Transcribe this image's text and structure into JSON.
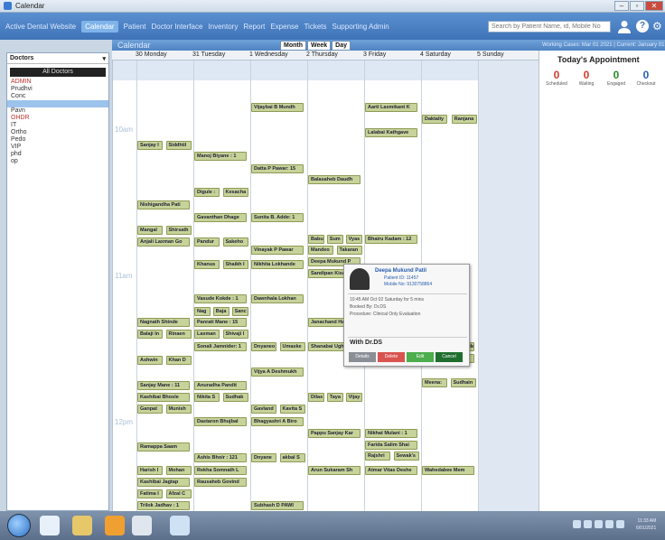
{
  "window": {
    "title": "Calendar",
    "buttons": [
      "–",
      "▫",
      "✕"
    ]
  },
  "menu": {
    "items": [
      "Active Dental Website",
      "Calendar",
      "Patient",
      "Doctor Interface",
      "Inventory",
      "Report",
      "Expense",
      "Tickets",
      "Supporting Admin"
    ],
    "active_index": 1,
    "search_placeholder": "Search by Patient Name, id, Mobile No"
  },
  "calendar": {
    "title": "Calendar",
    "views": [
      "Month",
      "Week",
      "Day"
    ],
    "days": [
      "30 Monday",
      "31 Tuesday",
      "1 Wednesday",
      "2 Thursday",
      "3 Friday",
      "4 Saturday",
      "5 Sunday"
    ],
    "time_labels": [
      "10am",
      "11am",
      "12pm"
    ]
  },
  "doctors": {
    "header": "Doctors",
    "all_label": "All Doctors",
    "list": [
      "ADMIN",
      "Prudhvi",
      "Conc",
      "",
      "Pavn",
      "OHDR",
      "IT",
      "Ortho",
      "Pedo",
      "VIP",
      "phd",
      "op"
    ]
  },
  "events": [
    {
      "d": 2,
      "t": 114,
      "label": "Vijaybai B Mundh"
    },
    {
      "d": 4,
      "t": 114,
      "label": "Aarti Laxmikant K"
    },
    {
      "d": 5,
      "t": 127,
      "label": "Daktaliy"
    },
    {
      "d": 5.52,
      "t": 127,
      "label": "Ranjana"
    },
    {
      "d": 4,
      "t": 142,
      "label": "Lalabai Kathgave"
    },
    {
      "d": 0,
      "t": 156,
      "label": "Sanjay I"
    },
    {
      "d": 0.5,
      "t": 156,
      "label": "Siddhiil"
    },
    {
      "d": 1,
      "t": 168,
      "label": "Manoj Biyane : 1"
    },
    {
      "d": 2,
      "t": 182,
      "label": "Datta P Pawar: 15"
    },
    {
      "d": 3,
      "t": 194,
      "label": "Balasaheb Daudh"
    },
    {
      "d": 1,
      "t": 208,
      "label": "Digule :"
    },
    {
      "d": 1.5,
      "t": 208,
      "label": "Kesacha"
    },
    {
      "d": 0,
      "t": 222,
      "label": "Nishigandha Pati"
    },
    {
      "d": 1,
      "t": 236,
      "label": "Gavanthan Dhage"
    },
    {
      "d": 2,
      "t": 236,
      "label": "Sunita B. Adde: 1"
    },
    {
      "d": 0,
      "t": 250,
      "label": "Mangal"
    },
    {
      "d": 0.5,
      "t": 250,
      "label": "Shirsath"
    },
    {
      "d": 3,
      "t": 260,
      "label": "Babu"
    },
    {
      "d": 3.33,
      "t": 260,
      "label": "Sum"
    },
    {
      "d": 3.66,
      "t": 260,
      "label": "Vyas"
    },
    {
      "d": 4,
      "t": 260,
      "label": "Bhairu Kadam : 12"
    },
    {
      "d": 0,
      "t": 263,
      "label": "Anjali Laxman Go"
    },
    {
      "d": 1,
      "t": 263,
      "label": "Pandur"
    },
    {
      "d": 1.5,
      "t": 263,
      "label": "Sakeho"
    },
    {
      "d": 2,
      "t": 272,
      "label": "Vinayak P Pawar"
    },
    {
      "d": 3,
      "t": 272,
      "label": "Mandeo"
    },
    {
      "d": 3.5,
      "t": 272,
      "label": "Takaran"
    },
    {
      "d": 3,
      "t": 285,
      "label": "Deepa Mukund P"
    },
    {
      "d": 1,
      "t": 288,
      "label": "Khanus"
    },
    {
      "d": 1.5,
      "t": 288,
      "label": "Shaikh I"
    },
    {
      "d": 2,
      "t": 288,
      "label": "Nikhita Lokhande"
    },
    {
      "d": 3,
      "t": 298,
      "label": "Sandipan Kisa"
    },
    {
      "d": 1,
      "t": 326,
      "label": "Vasude Kokde : 1"
    },
    {
      "d": 2,
      "t": 326,
      "label": "Dawnhala Lokhan"
    },
    {
      "d": 1,
      "t": 340,
      "label": "Nag"
    },
    {
      "d": 1.33,
      "t": 340,
      "label": "Baja"
    },
    {
      "d": 1.66,
      "t": 340,
      "label": "Sanc"
    },
    {
      "d": 0,
      "t": 352,
      "label": "Nagnath Shinde"
    },
    {
      "d": 1,
      "t": 352,
      "label": "Panrati Mane : 15"
    },
    {
      "d": 3,
      "t": 352,
      "label": "Janachand Hak"
    },
    {
      "d": 0,
      "t": 365,
      "label": "Balaji In"
    },
    {
      "d": 0.5,
      "t": 365,
      "label": "Rinaen"
    },
    {
      "d": 1,
      "t": 365,
      "label": "Laxman"
    },
    {
      "d": 1.5,
      "t": 365,
      "label": "Shivaji I"
    },
    {
      "d": 1,
      "t": 379,
      "label": "Sonali Jamnider: 1"
    },
    {
      "d": 2,
      "t": 379,
      "label": "Dnyaneo"
    },
    {
      "d": 2.5,
      "t": 379,
      "label": "Umaske"
    },
    {
      "d": 3,
      "t": 379,
      "label": "Shanabai Ugh"
    },
    {
      "d": 5,
      "t": 379,
      "label": "Shalan Abaso Gonde"
    },
    {
      "d": 0,
      "t": 394,
      "label": "Ashwin"
    },
    {
      "d": 0.5,
      "t": 394,
      "label": "Khan D"
    },
    {
      "d": 5,
      "t": 392,
      "label": "Shrishkala Prakas"
    },
    {
      "d": 2,
      "t": 407,
      "label": "Vijya A Deshmukh"
    },
    {
      "d": 5,
      "t": 419,
      "label": "Meena:"
    },
    {
      "d": 5.5,
      "t": 419,
      "label": "Sudhain"
    },
    {
      "d": 0,
      "t": 422,
      "label": "Sanjay Mane : 11"
    },
    {
      "d": 1,
      "t": 422,
      "label": "Anuradha Pandit"
    },
    {
      "d": 0,
      "t": 435,
      "label": "Kashibai Bhosle"
    },
    {
      "d": 1,
      "t": 435,
      "label": "Nikita S"
    },
    {
      "d": 1.5,
      "t": 435,
      "label": "Sudhak"
    },
    {
      "d": 3,
      "t": 435,
      "label": "Dilas"
    },
    {
      "d": 3.33,
      "t": 435,
      "label": "Taya"
    },
    {
      "d": 3.66,
      "t": 435,
      "label": "Vijay"
    },
    {
      "d": 0,
      "t": 448,
      "label": "Ganpat"
    },
    {
      "d": 0.5,
      "t": 448,
      "label": "Munish"
    },
    {
      "d": 2,
      "t": 448,
      "label": "Gavland"
    },
    {
      "d": 2.5,
      "t": 448,
      "label": "Kavita S"
    },
    {
      "d": 1,
      "t": 462,
      "label": "Dastaron Bhujbal"
    },
    {
      "d": 2,
      "t": 462,
      "label": "Bhagyashri A Biro"
    },
    {
      "d": 3,
      "t": 475,
      "label": "Pappu Sanjay Kar"
    },
    {
      "d": 4,
      "t": 475,
      "label": "Nikhat Mulani : 1"
    },
    {
      "d": 4,
      "t": 488,
      "label": "Farida Salim Shai"
    },
    {
      "d": 0,
      "t": 490,
      "label": "Ramappa Saam"
    },
    {
      "d": 4,
      "t": 500,
      "label": "Rajshri"
    },
    {
      "d": 4.5,
      "t": 500,
      "label": "Sewak's"
    },
    {
      "d": 1,
      "t": 502,
      "label": "Ashis Bhoir : 121"
    },
    {
      "d": 2,
      "t": 502,
      "label": "Dnyane"
    },
    {
      "d": 2.5,
      "t": 502,
      "label": "akbal S"
    },
    {
      "d": 0,
      "t": 516,
      "label": "Harish I"
    },
    {
      "d": 0.5,
      "t": 516,
      "label": "Mohan"
    },
    {
      "d": 1,
      "t": 516,
      "label": "Rekha Somnath L"
    },
    {
      "d": 3,
      "t": 516,
      "label": "Arun Sukaram Sh"
    },
    {
      "d": 4,
      "t": 516,
      "label": "Atmar Vitas Deshe"
    },
    {
      "d": 5,
      "t": 516,
      "label": "Wahedabee Mem"
    },
    {
      "d": 0,
      "t": 529,
      "label": "Kashibai Jagtap"
    },
    {
      "d": 1,
      "t": 529,
      "label": "Rausaheb Govind"
    },
    {
      "d": 0,
      "t": 542,
      "label": "Fatima I"
    },
    {
      "d": 0.5,
      "t": 542,
      "label": "Afzal C"
    },
    {
      "d": 0,
      "t": 555,
      "label": "Trilok Jadhav : 1"
    },
    {
      "d": 2,
      "t": 555,
      "label": "Subhash D PAWI"
    }
  ],
  "popup": {
    "name": "Deepa Mukund Patil",
    "patient_id": "Patient ID: 11457",
    "mobile": "Mobile No: 9130758864",
    "time": "10:45 AM Oct 02 Saturday for 5 mins",
    "booked": "Booked By: Dr.DS",
    "procedure": "Procedure: Clinical Only Evaluation",
    "with": "With Dr.DS",
    "buttons": [
      "Details",
      "Delete",
      "Edit",
      "Cancel"
    ],
    "button_colors": [
      "#8a8f96",
      "#d9534f",
      "#4cae4c",
      "#1f6e2f"
    ]
  },
  "right_panel": {
    "header": "Working Cases: Mar 01 2021 | Current: January 01 2021",
    "title": "Today's Appointment",
    "stats": [
      {
        "num": "0",
        "label": "Scheduled",
        "color": "#d23b2a"
      },
      {
        "num": "0",
        "label": "Waiting",
        "color": "#d23b2a"
      },
      {
        "num": "0",
        "label": "Engaged",
        "color": "#2a8a2a"
      },
      {
        "num": "0",
        "label": "Checkout",
        "color": "#2a5db0"
      }
    ]
  },
  "taskbar": {
    "clock_time": "11:33 AM",
    "clock_date": "6/01/2021"
  }
}
